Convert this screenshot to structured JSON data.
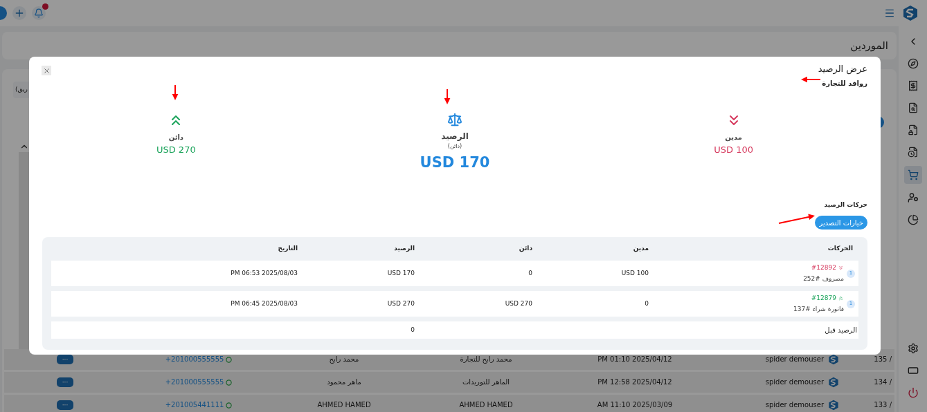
{
  "topbar": {
    "notifications": true
  },
  "page": {
    "title": "الموردين",
    "filter_text": "ريق)"
  },
  "background_rows": [
    {
      "number": "135 /",
      "user": "spider demouser",
      "date": "PM 01:10 2025/04/12",
      "company": "محمد رابح للتجارة",
      "name": "محمد رابح",
      "phone": "+201000555555",
      "action": "···"
    },
    {
      "number": "134 /",
      "user": "spider demouser",
      "date": "PM 12:58 2025/04/12",
      "company": "الماهر للتوريدات",
      "name": "ماهر محمود",
      "phone": "+201000555555",
      "action": "···"
    },
    {
      "number": "133 /",
      "user": "spider demouser",
      "date": "AM 11:10 2025/03/09",
      "company": "AHMED HAMED",
      "name": "AHMED HAMED",
      "phone": "+201005441111",
      "action": "···"
    }
  ],
  "modal": {
    "title": "عرض الرصيد",
    "subtitle": "روافد للتجارة",
    "summary": [
      {
        "kind": "debit",
        "label": "مدين",
        "amount": "USD 100"
      },
      {
        "kind": "balance",
        "label": "الرصيد",
        "note": "(دائن)",
        "amount": "USD 170"
      },
      {
        "kind": "credit",
        "label": "دائن",
        "amount": "USD 270"
      }
    ],
    "section_title": "حركات الرصيد",
    "export_button": "خيارات التصدير",
    "table": {
      "columns": [
        "الحركات",
        "مدين",
        "دائن",
        "الرصيد",
        "التاريخ"
      ],
      "rows": [
        {
          "kind": "debit",
          "count": "1",
          "ref": "#12892",
          "description": "مصروف #252",
          "debit": "USD 100",
          "credit": "0",
          "balance": "USD 170",
          "date": "PM 06:53 2025/08/03"
        },
        {
          "kind": "credit",
          "count": "1",
          "ref": "#12879",
          "description": "فاتورة شراء #137",
          "debit": "0",
          "credit": "USD 270",
          "balance": "USD 270",
          "date": "PM 06:45 2025/08/03"
        }
      ],
      "opening": {
        "label": "الرصيد قبل",
        "balance": "0"
      }
    }
  }
}
